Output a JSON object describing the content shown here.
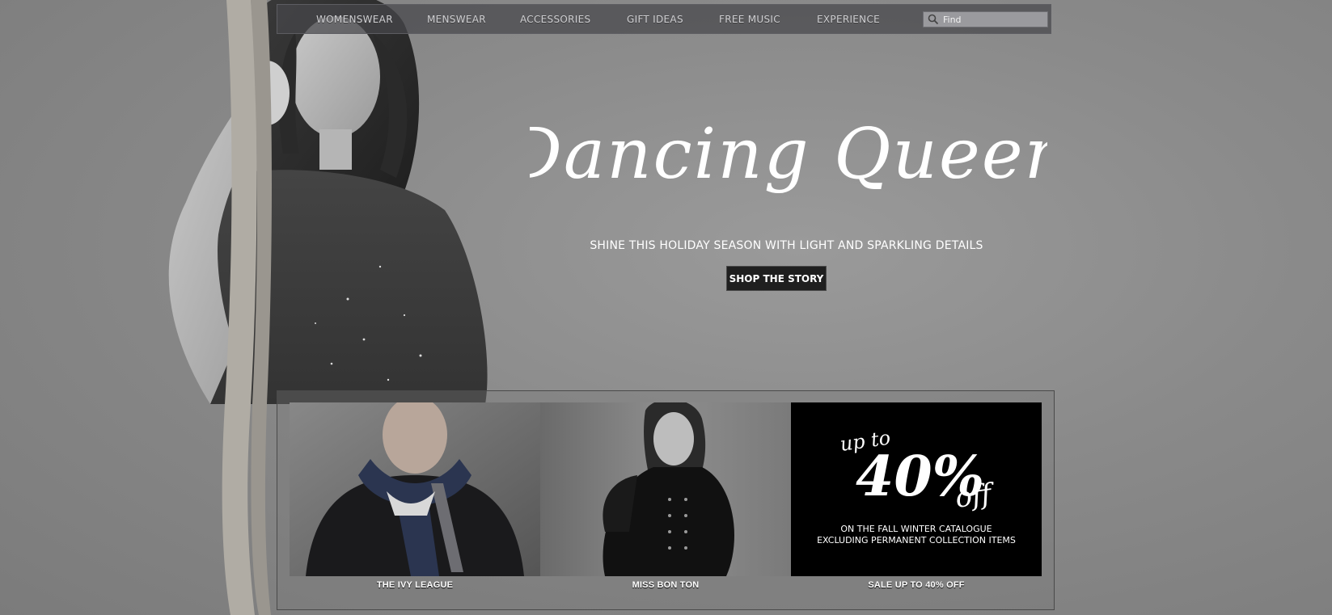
{
  "nav": {
    "items": [
      {
        "label": "WOMENSWEAR"
      },
      {
        "label": "MENSWEAR"
      },
      {
        "label": "ACCESSORIES"
      },
      {
        "label": "GIFT IDEAS"
      },
      {
        "label": "FREE MUSIC"
      },
      {
        "label": "EXPERIENCE"
      }
    ],
    "search_placeholder": "Find",
    "search_icon": "magnifier-icon"
  },
  "hero": {
    "title": "Dancing Queen",
    "subtitle": "SHINE THIS HOLIDAY SEASON WITH LIGHT AND SPARKLING DETAILS",
    "cta_label": "SHOP THE STORY"
  },
  "promos": [
    {
      "label": "THE IVY LEAGUE"
    },
    {
      "label": "MISS BON TON"
    },
    {
      "label": "SALE UP TO 40% OFF",
      "sale_upto": "up to",
      "sale_percent": "40%",
      "sale_off": "off",
      "sale_line1": "ON THE FALL WINTER CATALOGUE",
      "sale_line2": "EXCLUDING PERMANENT COLLECTION ITEMS"
    }
  ],
  "colors": {
    "background": "#8a8a8a",
    "nav_bg": "#46464b",
    "cta_bg": "#1f1f1f",
    "text": "#ffffff"
  }
}
